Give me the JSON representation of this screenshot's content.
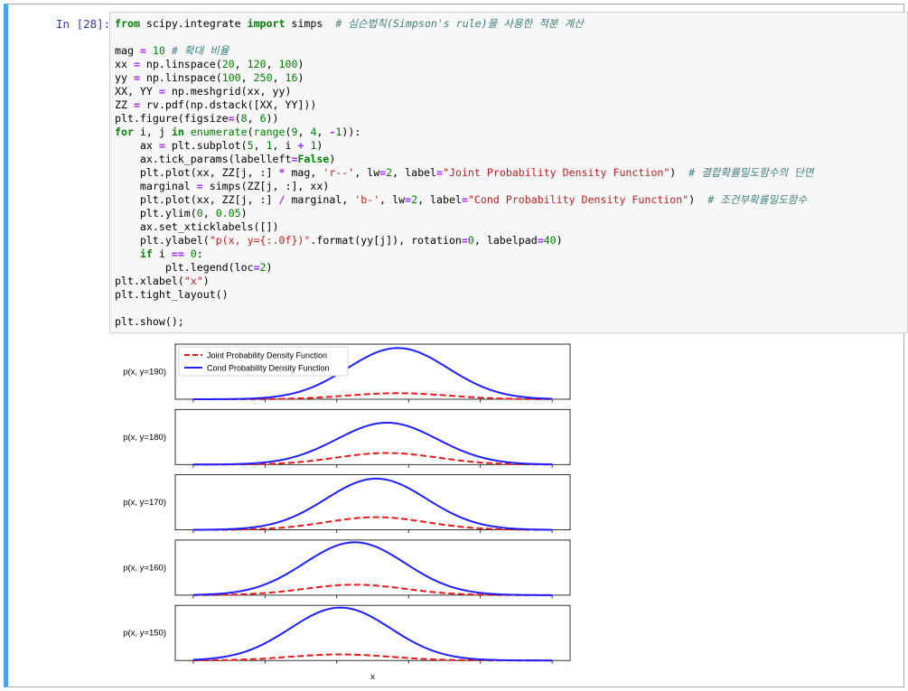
{
  "cell": {
    "prompt": "In [28]:",
    "code_lines": [
      [
        {
          "t": "kw",
          "v": "from"
        },
        {
          "t": "n",
          "v": " scipy.integrate "
        },
        {
          "t": "kw",
          "v": "import"
        },
        {
          "t": "n",
          "v": " simps  "
        },
        {
          "t": "cm",
          "v": "# 심슨법칙(Simpson's rule)을 사용한 적분 계산"
        }
      ],
      [],
      [
        {
          "t": "n",
          "v": "mag "
        },
        {
          "t": "op",
          "v": "="
        },
        {
          "t": "n",
          "v": " "
        },
        {
          "t": "num",
          "v": "10"
        },
        {
          "t": "n",
          "v": " "
        },
        {
          "t": "cm",
          "v": "# 확대 비율"
        }
      ],
      [
        {
          "t": "n",
          "v": "xx "
        },
        {
          "t": "op",
          "v": "="
        },
        {
          "t": "n",
          "v": " np.linspace("
        },
        {
          "t": "num",
          "v": "20"
        },
        {
          "t": "n",
          "v": ", "
        },
        {
          "t": "num",
          "v": "120"
        },
        {
          "t": "n",
          "v": ", "
        },
        {
          "t": "num",
          "v": "100"
        },
        {
          "t": "n",
          "v": ")"
        }
      ],
      [
        {
          "t": "n",
          "v": "yy "
        },
        {
          "t": "op",
          "v": "="
        },
        {
          "t": "n",
          "v": " np.linspace("
        },
        {
          "t": "num",
          "v": "100"
        },
        {
          "t": "n",
          "v": ", "
        },
        {
          "t": "num",
          "v": "250"
        },
        {
          "t": "n",
          "v": ", "
        },
        {
          "t": "num",
          "v": "16"
        },
        {
          "t": "n",
          "v": ")"
        }
      ],
      [
        {
          "t": "n",
          "v": "XX, YY "
        },
        {
          "t": "op",
          "v": "="
        },
        {
          "t": "n",
          "v": " np.meshgrid(xx, yy)"
        }
      ],
      [
        {
          "t": "n",
          "v": "ZZ "
        },
        {
          "t": "op",
          "v": "="
        },
        {
          "t": "n",
          "v": " rv.pdf(np.dstack([XX, YY]))"
        }
      ],
      [
        {
          "t": "n",
          "v": "plt.figure(figsize"
        },
        {
          "t": "op",
          "v": "="
        },
        {
          "t": "n",
          "v": "("
        },
        {
          "t": "num",
          "v": "8"
        },
        {
          "t": "n",
          "v": ", "
        },
        {
          "t": "num",
          "v": "6"
        },
        {
          "t": "n",
          "v": "))"
        }
      ],
      [
        {
          "t": "kw",
          "v": "for"
        },
        {
          "t": "n",
          "v": " i, j "
        },
        {
          "t": "kw",
          "v": "in"
        },
        {
          "t": "n",
          "v": " "
        },
        {
          "t": "num",
          "v": "enumerate"
        },
        {
          "t": "n",
          "v": "("
        },
        {
          "t": "num",
          "v": "range"
        },
        {
          "t": "n",
          "v": "("
        },
        {
          "t": "num",
          "v": "9"
        },
        {
          "t": "n",
          "v": ", "
        },
        {
          "t": "num",
          "v": "4"
        },
        {
          "t": "n",
          "v": ", "
        },
        {
          "t": "op",
          "v": "-"
        },
        {
          "t": "num",
          "v": "1"
        },
        {
          "t": "n",
          "v": ")):"
        }
      ],
      [
        {
          "t": "n",
          "v": "    ax "
        },
        {
          "t": "op",
          "v": "="
        },
        {
          "t": "n",
          "v": " plt.subplot("
        },
        {
          "t": "num",
          "v": "5"
        },
        {
          "t": "n",
          "v": ", "
        },
        {
          "t": "num",
          "v": "1"
        },
        {
          "t": "n",
          "v": ", i "
        },
        {
          "t": "op",
          "v": "+"
        },
        {
          "t": "n",
          "v": " "
        },
        {
          "t": "num",
          "v": "1"
        },
        {
          "t": "n",
          "v": ")"
        }
      ],
      [
        {
          "t": "n",
          "v": "    ax.tick_params(labelleft"
        },
        {
          "t": "op",
          "v": "="
        },
        {
          "t": "kw",
          "v": "False"
        },
        {
          "t": "n",
          "v": ")"
        }
      ],
      [
        {
          "t": "n",
          "v": "    plt.plot(xx, ZZ[j, :] "
        },
        {
          "t": "op",
          "v": "*"
        },
        {
          "t": "n",
          "v": " mag, "
        },
        {
          "t": "str",
          "v": "'r--'"
        },
        {
          "t": "n",
          "v": ", lw"
        },
        {
          "t": "op",
          "v": "="
        },
        {
          "t": "num",
          "v": "2"
        },
        {
          "t": "n",
          "v": ", label"
        },
        {
          "t": "op",
          "v": "="
        },
        {
          "t": "str",
          "v": "\"Joint Probability Density Function\""
        },
        {
          "t": "n",
          "v": ")  "
        },
        {
          "t": "cm",
          "v": "# 결합확률밀도함수의 단면"
        }
      ],
      [
        {
          "t": "n",
          "v": "    marginal "
        },
        {
          "t": "op",
          "v": "="
        },
        {
          "t": "n",
          "v": " simps(ZZ[j, :], xx)"
        }
      ],
      [
        {
          "t": "n",
          "v": "    plt.plot(xx, ZZ[j, :] "
        },
        {
          "t": "op",
          "v": "/"
        },
        {
          "t": "n",
          "v": " marginal, "
        },
        {
          "t": "str",
          "v": "'b-'"
        },
        {
          "t": "n",
          "v": ", lw"
        },
        {
          "t": "op",
          "v": "="
        },
        {
          "t": "num",
          "v": "2"
        },
        {
          "t": "n",
          "v": ", label"
        },
        {
          "t": "op",
          "v": "="
        },
        {
          "t": "str",
          "v": "\"Cond Probability Density Function\""
        },
        {
          "t": "n",
          "v": ")  "
        },
        {
          "t": "cm",
          "v": "# 조건부확률밀도함수"
        }
      ],
      [
        {
          "t": "n",
          "v": "    plt.ylim("
        },
        {
          "t": "num",
          "v": "0"
        },
        {
          "t": "n",
          "v": ", "
        },
        {
          "t": "num",
          "v": "0.05"
        },
        {
          "t": "n",
          "v": ")"
        }
      ],
      [
        {
          "t": "n",
          "v": "    ax.set_xticklabels([])"
        }
      ],
      [
        {
          "t": "n",
          "v": "    plt.ylabel("
        },
        {
          "t": "str",
          "v": "\"p(x, y={:.0f})\""
        },
        {
          "t": "n",
          "v": ".format(yy[j]), rotation"
        },
        {
          "t": "op",
          "v": "="
        },
        {
          "t": "num",
          "v": "0"
        },
        {
          "t": "n",
          "v": ", labelpad"
        },
        {
          "t": "op",
          "v": "="
        },
        {
          "t": "num",
          "v": "40"
        },
        {
          "t": "n",
          "v": ")"
        }
      ],
      [
        {
          "t": "n",
          "v": "    "
        },
        {
          "t": "kw",
          "v": "if"
        },
        {
          "t": "n",
          "v": " i "
        },
        {
          "t": "op",
          "v": "=="
        },
        {
          "t": "n",
          "v": " "
        },
        {
          "t": "num",
          "v": "0"
        },
        {
          "t": "n",
          "v": ":"
        }
      ],
      [
        {
          "t": "n",
          "v": "        plt.legend(loc"
        },
        {
          "t": "op",
          "v": "="
        },
        {
          "t": "num",
          "v": "2"
        },
        {
          "t": "n",
          "v": ")"
        }
      ],
      [
        {
          "t": "n",
          "v": "plt.xlabel("
        },
        {
          "t": "str",
          "v": "\"x\""
        },
        {
          "t": "n",
          "v": ")"
        }
      ],
      [
        {
          "t": "n",
          "v": "plt.tight_layout()"
        }
      ],
      [],
      [
        {
          "t": "n",
          "v": "plt.show();"
        }
      ]
    ]
  },
  "chart_data": {
    "type": "line",
    "xlabel": "x",
    "xlim": [
      20,
      120
    ],
    "ylim": [
      0,
      0.05
    ],
    "legend_location": "top-left",
    "series_styles": {
      "joint": {
        "color": "#e41a1c",
        "dash": "dashed"
      },
      "cond": {
        "color": "#1f1fff",
        "dash": "solid"
      }
    },
    "legend": [
      "Joint Probability Density Function",
      "Cond Probability Density Function"
    ],
    "subplots": [
      {
        "ylabel": "p(x, y=190)",
        "joint": {
          "mean": 77,
          "sd": 14,
          "peak": 0.0055
        },
        "cond": {
          "mean": 77,
          "sd": 14,
          "peak": 0.0465
        }
      },
      {
        "ylabel": "p(x, y=180)",
        "joint": {
          "mean": 74,
          "sd": 14,
          "peak": 0.0105
        },
        "cond": {
          "mean": 74,
          "sd": 14,
          "peak": 0.038
        }
      },
      {
        "ylabel": "p(x, y=170)",
        "joint": {
          "mean": 71,
          "sd": 14,
          "peak": 0.0115
        },
        "cond": {
          "mean": 71,
          "sd": 14,
          "peak": 0.0465
        }
      },
      {
        "ylabel": "p(x, y=160)",
        "joint": {
          "mean": 65,
          "sd": 14,
          "peak": 0.0095
        },
        "cond": {
          "mean": 65,
          "sd": 14,
          "peak": 0.048
        }
      },
      {
        "ylabel": "p(x, y=150)",
        "joint": {
          "mean": 61,
          "sd": 14,
          "peak": 0.0055
        },
        "cond": {
          "mean": 61,
          "sd": 14,
          "peak": 0.048
        }
      }
    ]
  }
}
